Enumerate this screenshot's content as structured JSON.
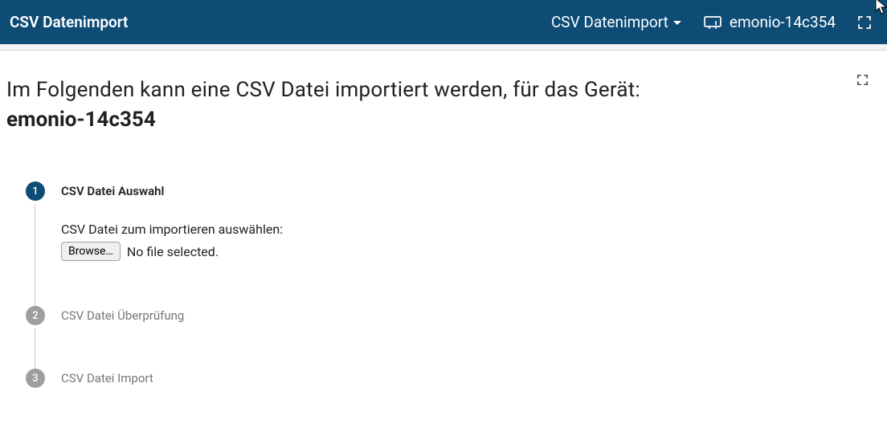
{
  "header": {
    "title": "CSV Datenimport",
    "dropdown_label": "CSV Datenimport",
    "device_name": "emonio-14c354"
  },
  "intro": {
    "text": "Im Folgenden kann eine CSV Datei importiert werden, für das Gerät:",
    "device": "emonio-14c354"
  },
  "steps": [
    {
      "number": "1",
      "label": "CSV Datei Auswahl",
      "active": true,
      "body_text": "CSV Datei zum importieren auswählen:",
      "browse_label": "Browse…",
      "no_file_label": "No file selected."
    },
    {
      "number": "2",
      "label": "CSV Datei Überprüfung",
      "active": false
    },
    {
      "number": "3",
      "label": "CSV Datei Import",
      "active": false
    }
  ]
}
